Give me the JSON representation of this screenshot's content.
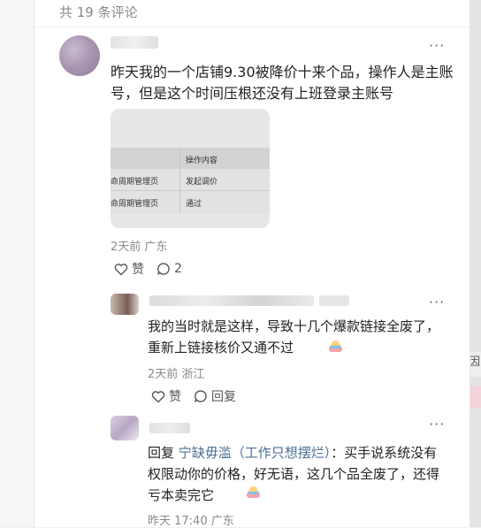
{
  "header": {
    "count_text": "共 19 条评论"
  },
  "main_comment": {
    "text": "昨天我的一个店铺9.30被降价十来个品，操作人是主账号，但是这个时间压根还没有上班登录主账号",
    "image": {
      "header_col2": "操作内容",
      "rows": [
        {
          "col1": "命周期管理页",
          "col2": "发起调价"
        },
        {
          "col1": "命周期管理页",
          "col2": "通过"
        }
      ]
    },
    "meta": "2天前 广东",
    "like_label": "赞",
    "reply_count": "2",
    "more": "···"
  },
  "reply1": {
    "text": "我的当时就是这样，导致十几个爆款链接全废了，重新上链接核价又通不过",
    "meta": "2天前 浙江",
    "like_label": "赞",
    "reply_label": "回复",
    "more": "···"
  },
  "reply2": {
    "prefix": "回复 ",
    "mention": "宁缺毋滥（工作只想摆烂）",
    "text": "：买手说系统没有权限动你的价格，好无语，这几个品全废了，还得亏本卖完它",
    "meta": "昨天 17:40 广东",
    "more": "···"
  },
  "right_peek": {
    "text": "因"
  },
  "icons": {
    "like": "heart-outline-icon",
    "comment": "chat-bubble-icon",
    "more": "more-dots-icon"
  }
}
